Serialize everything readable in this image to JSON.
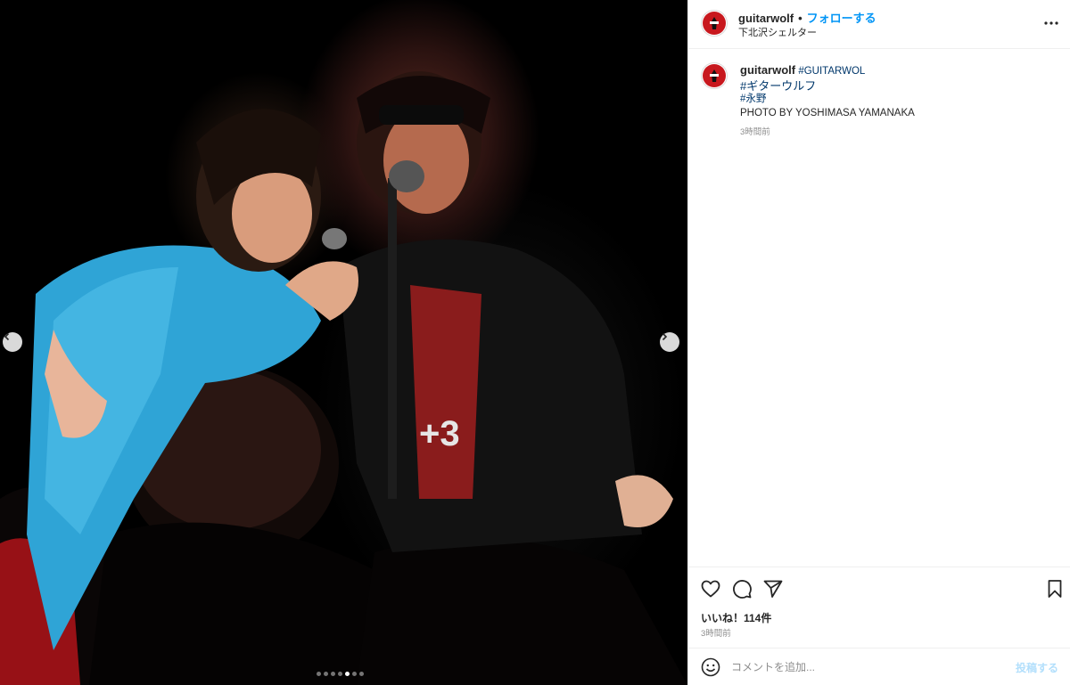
{
  "post": {
    "photo_alt": "live performance photo",
    "carousel": {
      "count": 7,
      "active_index": 4
    }
  },
  "header": {
    "username": "guitarwolf",
    "separator": "•",
    "follow_label": "フォローする",
    "location": "下北沢シェルター"
  },
  "caption": {
    "username": "guitarwolf",
    "tag_line1": "#GUITARWOL",
    "tag_line2": "#ギターウルフ",
    "tag_line3": "#永野",
    "credit": "PHOTO BY YOSHIMASA YAMANAKA",
    "time": "3時間前"
  },
  "actions": {
    "likes": "いいね！114件",
    "time": "3時間前"
  },
  "comment": {
    "placeholder": "コメントを追加...",
    "post_label": "投稿する"
  },
  "colors": {
    "accent_blue": "#0095f6",
    "hashtag_blue": "#00376b",
    "post_disabled": "#b2dffc",
    "avatar_red": "#c8181e"
  }
}
